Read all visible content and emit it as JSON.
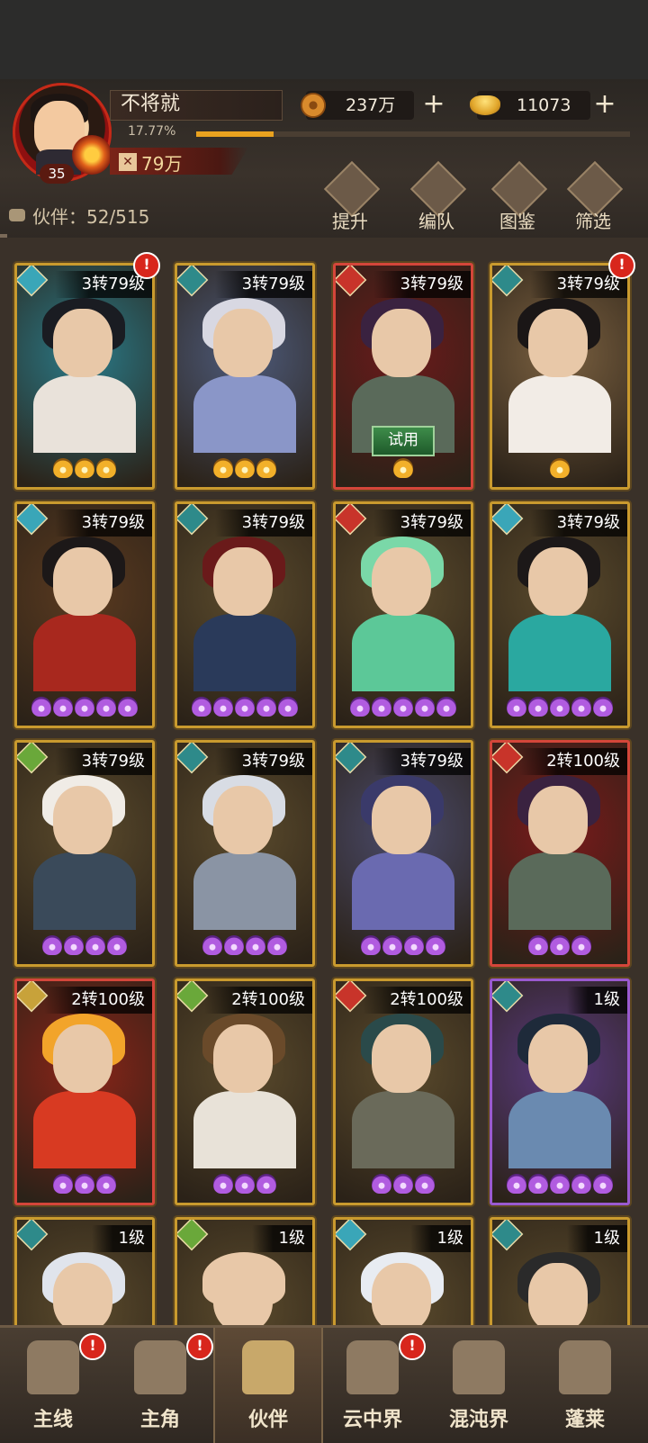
{
  "player": {
    "name": "不将就",
    "level": "35",
    "exp_percent_text": "17.77%",
    "exp_fraction": 0.1777,
    "power": "79万"
  },
  "currencies": {
    "copper": "237万",
    "gold": "11073"
  },
  "actions": [
    {
      "label": "提升",
      "icon": "upgrade-arrows-icon"
    },
    {
      "label": "编队",
      "icon": "flag-formation-icon"
    },
    {
      "label": "图鉴",
      "icon": "scroll-book-icon"
    },
    {
      "label": "筛选",
      "icon": "filter-diamond-icon"
    }
  ],
  "partner_count": "伙伴：52/515",
  "cards": [
    {
      "level": "3转79级",
      "stars": 3,
      "star_color": "gold",
      "element": "water",
      "frame": "gold",
      "alert": true,
      "trial": false,
      "palette": [
        "#2a7a88",
        "#1a1c22",
        "#e9e2da"
      ]
    },
    {
      "level": "3转79级",
      "stars": 3,
      "star_color": "gold",
      "element": "dark",
      "frame": "gold",
      "alert": false,
      "trial": false,
      "palette": [
        "#4d5a7a",
        "#d8d8e2",
        "#8a96c8"
      ]
    },
    {
      "level": "3转79级",
      "stars": 1,
      "star_color": "gold",
      "element": "fire",
      "frame": "red",
      "alert": false,
      "trial": true,
      "palette": [
        "#6a1a1a",
        "#3a2240",
        "#5a6a5a"
      ]
    },
    {
      "level": "3转79级",
      "stars": 1,
      "star_color": "gold",
      "element": "dark",
      "frame": "gold",
      "alert": true,
      "trial": false,
      "palette": [
        "#7a6040",
        "#1a1616",
        "#f2ece6"
      ]
    },
    {
      "level": "3转79级",
      "stars": 5,
      "star_color": "purple",
      "element": "water",
      "frame": "gold",
      "alert": false,
      "trial": false,
      "palette": [
        "#5a3a20",
        "#1c1818",
        "#a8281e"
      ]
    },
    {
      "level": "3转79级",
      "stars": 5,
      "star_color": "purple",
      "element": "dark",
      "frame": "gold",
      "alert": false,
      "trial": false,
      "palette": [
        "#5a4a2c",
        "#6a1a1a",
        "#2a3a5a"
      ]
    },
    {
      "level": "3转79级",
      "stars": 5,
      "star_color": "purple",
      "element": "fire",
      "frame": "gold",
      "alert": false,
      "trial": false,
      "palette": [
        "#5a4a2c",
        "#7ad8a8",
        "#5cc898"
      ]
    },
    {
      "level": "3转79级",
      "stars": 5,
      "star_color": "purple",
      "element": "water",
      "frame": "gold",
      "alert": false,
      "trial": false,
      "palette": [
        "#5a4a2c",
        "#1c1818",
        "#2aa8a0"
      ]
    },
    {
      "level": "3转79级",
      "stars": 4,
      "star_color": "purple",
      "element": "wood",
      "frame": "gold",
      "alert": false,
      "trial": false,
      "palette": [
        "#5a4a2c",
        "#f0ece6",
        "#3a4a5a"
      ]
    },
    {
      "level": "3转79级",
      "stars": 4,
      "star_color": "purple",
      "element": "dark",
      "frame": "gold",
      "alert": false,
      "trial": false,
      "palette": [
        "#5a4a2c",
        "#d8dce4",
        "#8a94a4"
      ]
    },
    {
      "level": "3转79级",
      "stars": 4,
      "star_color": "purple",
      "element": "dark",
      "frame": "gold",
      "alert": false,
      "trial": false,
      "palette": [
        "#4a4a6a",
        "#3a3a6a",
        "#6a6ab0"
      ]
    },
    {
      "level": "2转100级",
      "stars": 3,
      "star_color": "purple",
      "element": "fire",
      "frame": "red",
      "alert": false,
      "trial": false,
      "palette": [
        "#7a1a1a",
        "#3a2240",
        "#5a6a5a"
      ]
    },
    {
      "level": "2转100级",
      "stars": 3,
      "star_color": "purple",
      "element": "earth",
      "frame": "red",
      "alert": false,
      "trial": false,
      "palette": [
        "#8a2418",
        "#f2a42a",
        "#d83a22"
      ]
    },
    {
      "level": "2转100级",
      "stars": 3,
      "star_color": "purple",
      "element": "wood",
      "frame": "gold",
      "alert": false,
      "trial": false,
      "palette": [
        "#5a4a2c",
        "#6a4a2a",
        "#e8e2d8"
      ]
    },
    {
      "level": "2转100级",
      "stars": 3,
      "star_color": "purple",
      "element": "fire",
      "frame": "gold",
      "alert": false,
      "trial": false,
      "palette": [
        "#5a4a2c",
        "#2a4a4a",
        "#6a6a5a"
      ]
    },
    {
      "level": "1级",
      "stars": 5,
      "star_color": "purple",
      "element": "dark",
      "frame": "purple",
      "alert": false,
      "trial": false,
      "palette": [
        "#5a3a80",
        "#1e2a3a",
        "#6a8ab0"
      ]
    },
    {
      "level": "1级",
      "stars": 0,
      "star_color": "purple",
      "element": "dark",
      "frame": "gold",
      "alert": false,
      "trial": false,
      "palette": [
        "#5a4a2c",
        "#e0e4ec",
        "#8a94a4"
      ]
    },
    {
      "level": "1级",
      "stars": 0,
      "star_color": "purple",
      "element": "wood",
      "frame": "gold",
      "alert": false,
      "trial": false,
      "palette": [
        "#5a4a2c",
        "#e8c8a8",
        "#c08a6a"
      ]
    },
    {
      "level": "1级",
      "stars": 0,
      "star_color": "purple",
      "element": "water",
      "frame": "gold",
      "alert": false,
      "trial": false,
      "palette": [
        "#5a4a2c",
        "#e8ecf2",
        "#c0c8d4"
      ]
    },
    {
      "level": "1级",
      "stars": 0,
      "star_color": "purple",
      "element": "dark",
      "frame": "gold",
      "alert": false,
      "trial": false,
      "palette": [
        "#5a4a2c",
        "#2a2a2a",
        "#7a3a2a"
      ]
    }
  ],
  "trial_label": "试用",
  "alert_mark": "!",
  "element_colors": {
    "water": "#3aa6b8",
    "dark": "#2e8a8a",
    "fire": "#c8342a",
    "wood": "#6aa83a",
    "earth": "#c8a23a"
  },
  "nav": [
    {
      "label": "主线",
      "icon": "crossed-swords-icon",
      "alert": true,
      "active": false
    },
    {
      "label": "主角",
      "icon": "hero-portrait-icon",
      "alert": true,
      "active": false
    },
    {
      "label": "伙伴",
      "icon": "partner-helmet-icon",
      "alert": false,
      "active": true
    },
    {
      "label": "云中界",
      "icon": "pagoda-icon",
      "alert": true,
      "active": false
    },
    {
      "label": "混沌界",
      "icon": "chaos-gate-icon",
      "alert": false,
      "active": false
    },
    {
      "label": "蓬莱",
      "icon": "immortal-icon",
      "alert": false,
      "active": false
    }
  ]
}
